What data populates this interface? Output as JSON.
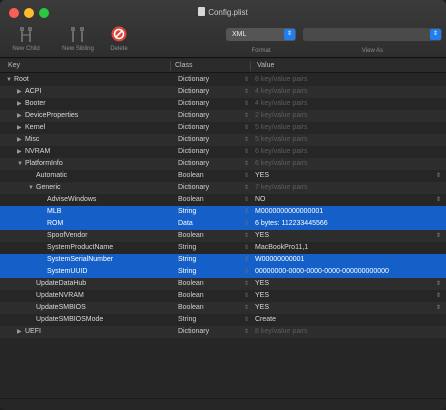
{
  "window": {
    "title": "Config.plist"
  },
  "toolbar": {
    "new_child": "New Child",
    "new_sibling": "New Sibling",
    "delete": "Delete",
    "format_value": "XML",
    "format_label": "Format",
    "view_as_value": "",
    "view_as_label": "View As"
  },
  "columns": {
    "key": "Key",
    "class": "Class",
    "value": "Value"
  },
  "rows": [
    {
      "key": "Root",
      "class": "Dictionary",
      "value": "8 key/value pairs",
      "dim": true,
      "indent": 0,
      "disc": "▼"
    },
    {
      "key": "ACPI",
      "class": "Dictionary",
      "value": "4 key/value pairs",
      "dim": true,
      "indent": 1,
      "disc": "▶"
    },
    {
      "key": "Booter",
      "class": "Dictionary",
      "value": "4 key/value pairs",
      "dim": true,
      "indent": 1,
      "disc": "▶"
    },
    {
      "key": "DeviceProperties",
      "class": "Dictionary",
      "value": "2 key/value pairs",
      "dim": true,
      "indent": 1,
      "disc": "▶"
    },
    {
      "key": "Kernel",
      "class": "Dictionary",
      "value": "5 key/value pairs",
      "dim": true,
      "indent": 1,
      "disc": "▶"
    },
    {
      "key": "Misc",
      "class": "Dictionary",
      "value": "5 key/value pairs",
      "dim": true,
      "indent": 1,
      "disc": "▶"
    },
    {
      "key": "NVRAM",
      "class": "Dictionary",
      "value": "6 key/value pairs",
      "dim": true,
      "indent": 1,
      "disc": "▶"
    },
    {
      "key": "PlatformInfo",
      "class": "Dictionary",
      "value": "6 key/value pairs",
      "dim": true,
      "indent": 1,
      "disc": "▼"
    },
    {
      "key": "Automatic",
      "class": "Boolean",
      "value": "YES",
      "dim": false,
      "indent": 2,
      "disc": ""
    },
    {
      "key": "Generic",
      "class": "Dictionary",
      "value": "7 key/value pairs",
      "dim": true,
      "indent": 2,
      "disc": "▼"
    },
    {
      "key": "AdviseWindows",
      "class": "Boolean",
      "value": "NO",
      "dim": false,
      "indent": 3,
      "disc": ""
    },
    {
      "key": "MLB",
      "class": "String",
      "value": "M0000000000000001",
      "dim": false,
      "indent": 3,
      "disc": "",
      "selected": true
    },
    {
      "key": "ROM",
      "class": "Data",
      "value": "6 bytes: 112233445566",
      "dim": false,
      "indent": 3,
      "disc": "",
      "selected": true
    },
    {
      "key": "SpoofVendor",
      "class": "Boolean",
      "value": "YES",
      "dim": false,
      "indent": 3,
      "disc": ""
    },
    {
      "key": "SystemProductName",
      "class": "String",
      "value": "MacBookPro11,1",
      "dim": false,
      "indent": 3,
      "disc": ""
    },
    {
      "key": "SystemSerialNumber",
      "class": "String",
      "value": "W00000000001",
      "dim": false,
      "indent": 3,
      "disc": "",
      "selected": true
    },
    {
      "key": "SystemUUID",
      "class": "String",
      "value": "00000000-0000-0000-0000-000000000000",
      "dim": false,
      "indent": 3,
      "disc": "",
      "selected": true
    },
    {
      "key": "UpdateDataHub",
      "class": "Boolean",
      "value": "YES",
      "dim": false,
      "indent": 2,
      "disc": ""
    },
    {
      "key": "UpdateNVRAM",
      "class": "Boolean",
      "value": "YES",
      "dim": false,
      "indent": 2,
      "disc": ""
    },
    {
      "key": "UpdateSMBIOS",
      "class": "Boolean",
      "value": "YES",
      "dim": false,
      "indent": 2,
      "disc": ""
    },
    {
      "key": "UpdateSMBIOSMode",
      "class": "String",
      "value": "Create",
      "dim": false,
      "indent": 2,
      "disc": ""
    },
    {
      "key": "UEFI",
      "class": "Dictionary",
      "value": "8 key/value pairs",
      "dim": true,
      "indent": 1,
      "disc": "▶"
    }
  ],
  "colors": {
    "selection": "#1560c8",
    "accent": "#1f7ef0",
    "delete": "#e0443a"
  }
}
